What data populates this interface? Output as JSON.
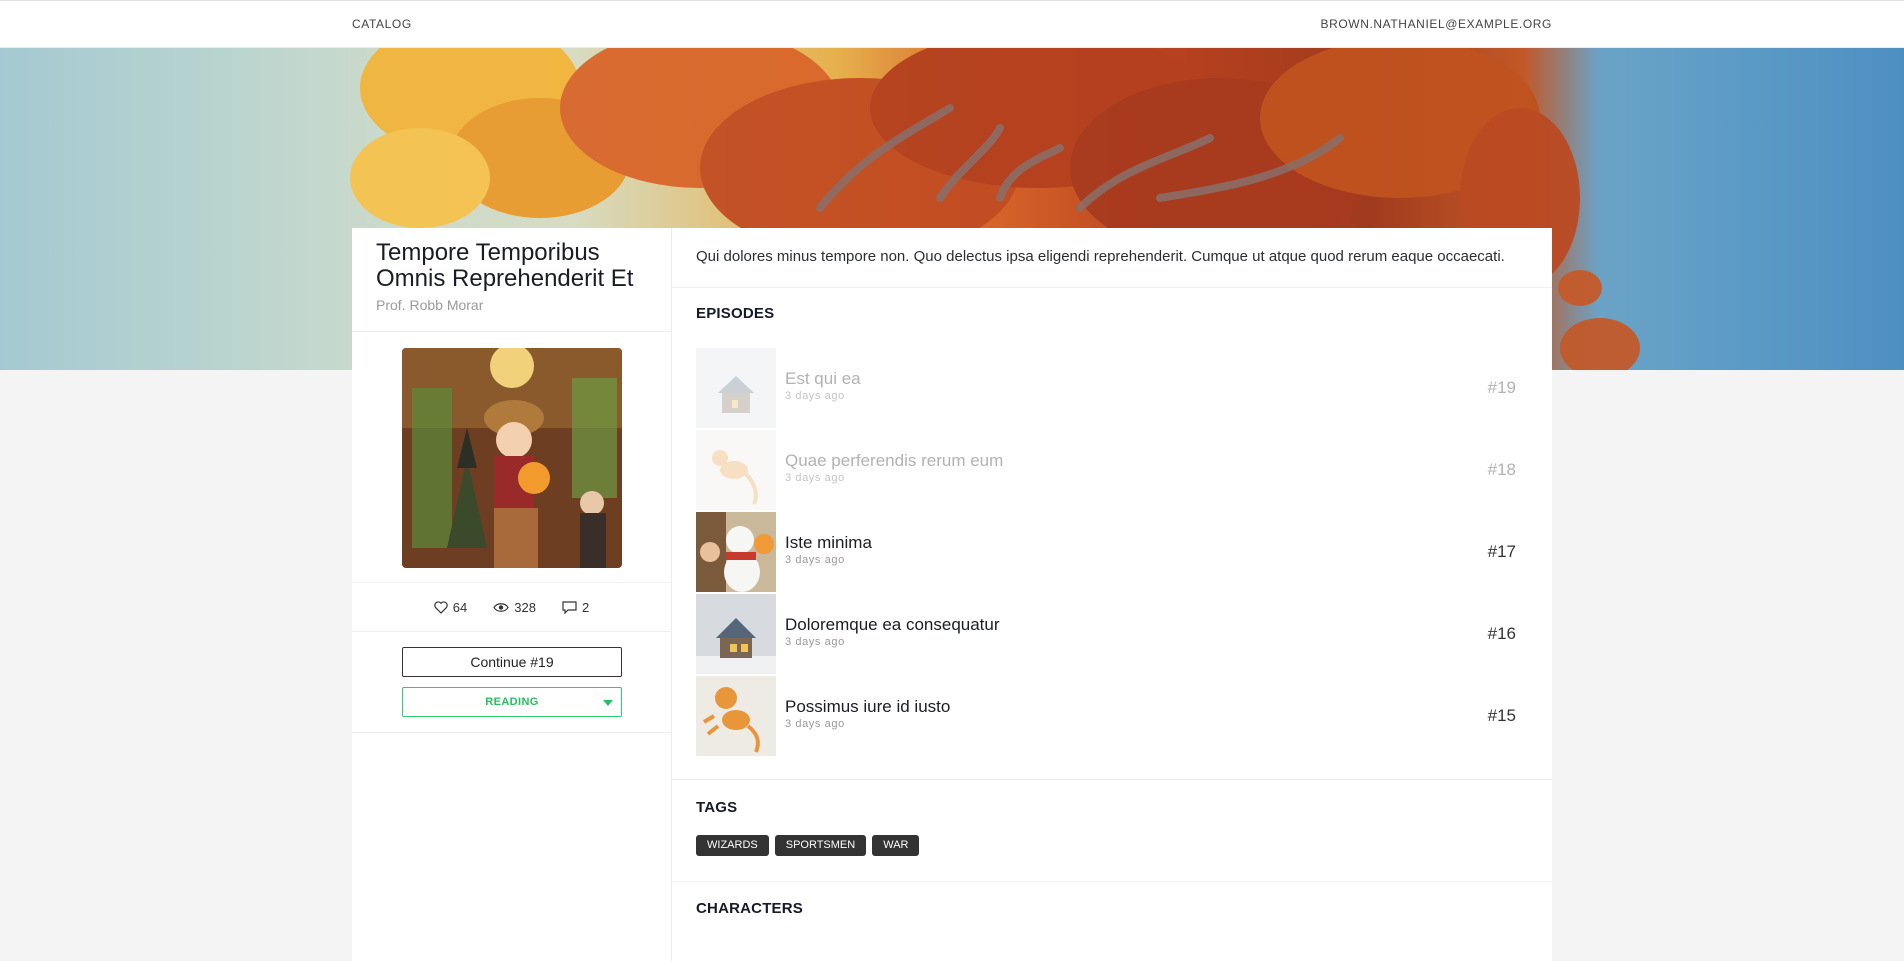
{
  "nav": {
    "catalog": "CATALOG",
    "user": "BROWN.NATHANIEL@EXAMPLE.ORG"
  },
  "comic": {
    "title": "Tempore Temporibus Omnis Reprehenderit Et",
    "author": "Prof. Robb Morar",
    "description": "Qui dolores minus tempore non. Quo delectus ipsa eligendi reprehenderit. Cumque ut atque quod rerum eaque occaecati.",
    "stats": {
      "likes": "64",
      "views": "328",
      "comments": "2",
      "likes_icon": "heart-icon",
      "views_icon": "eye-icon",
      "comments_icon": "comment-icon"
    },
    "continue_label": "Continue #19",
    "status_label": "READING"
  },
  "sections": {
    "episodes": "EPISODES",
    "tags": "TAGS",
    "characters": "CHARACTERS"
  },
  "episodes": [
    {
      "title": "Est qui ea",
      "time": "3 days ago",
      "number": "#19",
      "read": true
    },
    {
      "title": "Quae perferendis rerum eum",
      "time": "3 days ago",
      "number": "#18",
      "read": true
    },
    {
      "title": "Iste minima",
      "time": "3 days ago",
      "number": "#17",
      "read": false
    },
    {
      "title": "Doloremque ea consequatur",
      "time": "3 days ago",
      "number": "#16",
      "read": false
    },
    {
      "title": "Possimus iure id iusto",
      "time": "3 days ago",
      "number": "#15",
      "read": false
    }
  ],
  "tags": [
    "WIZARDS",
    "SPORTSMEN",
    "WAR"
  ],
  "colors": {
    "accent_green": "#27c25f",
    "tag_bg": "#333333",
    "page_bg": "#f4f4f4"
  }
}
